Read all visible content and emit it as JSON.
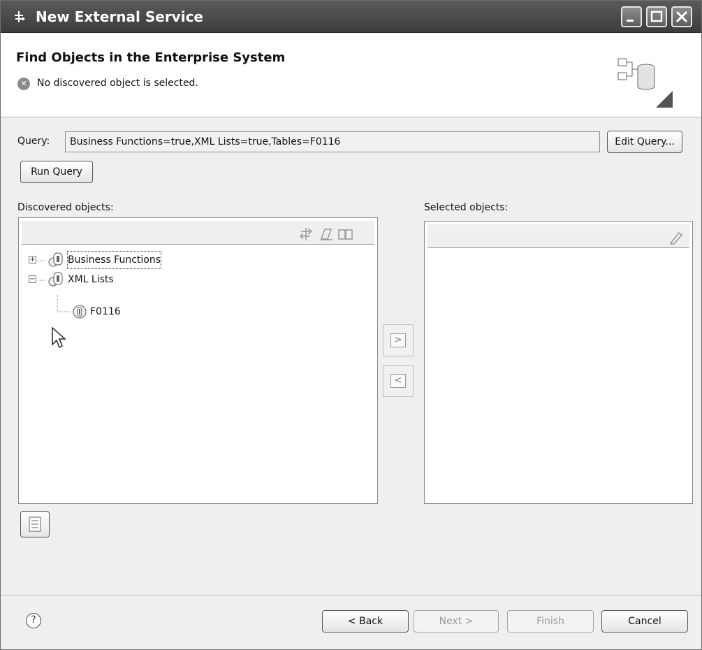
{
  "window": {
    "title": "New External Service"
  },
  "banner": {
    "heading": "Find Objects in the Enterprise System",
    "message": "No discovered object is selected."
  },
  "query": {
    "label": "Query:",
    "value": "Business Functions=true,XML Lists=true,Tables=F0116",
    "edit_button": "Edit Query...",
    "run_button": "Run Query"
  },
  "discovered": {
    "label": "Discovered objects:",
    "tree": [
      {
        "label": "Business Functions",
        "expanded": false
      },
      {
        "label": "XML Lists",
        "expanded": true
      },
      {
        "label": "F0116",
        "expanded": null
      }
    ]
  },
  "selected": {
    "label": "Selected objects:"
  },
  "transfer": {
    "add_label": ">",
    "remove_label": "<"
  },
  "footer": {
    "back": "< Back",
    "next": "Next >",
    "finish": "Finish",
    "cancel": "Cancel",
    "help_glyph": "?"
  }
}
